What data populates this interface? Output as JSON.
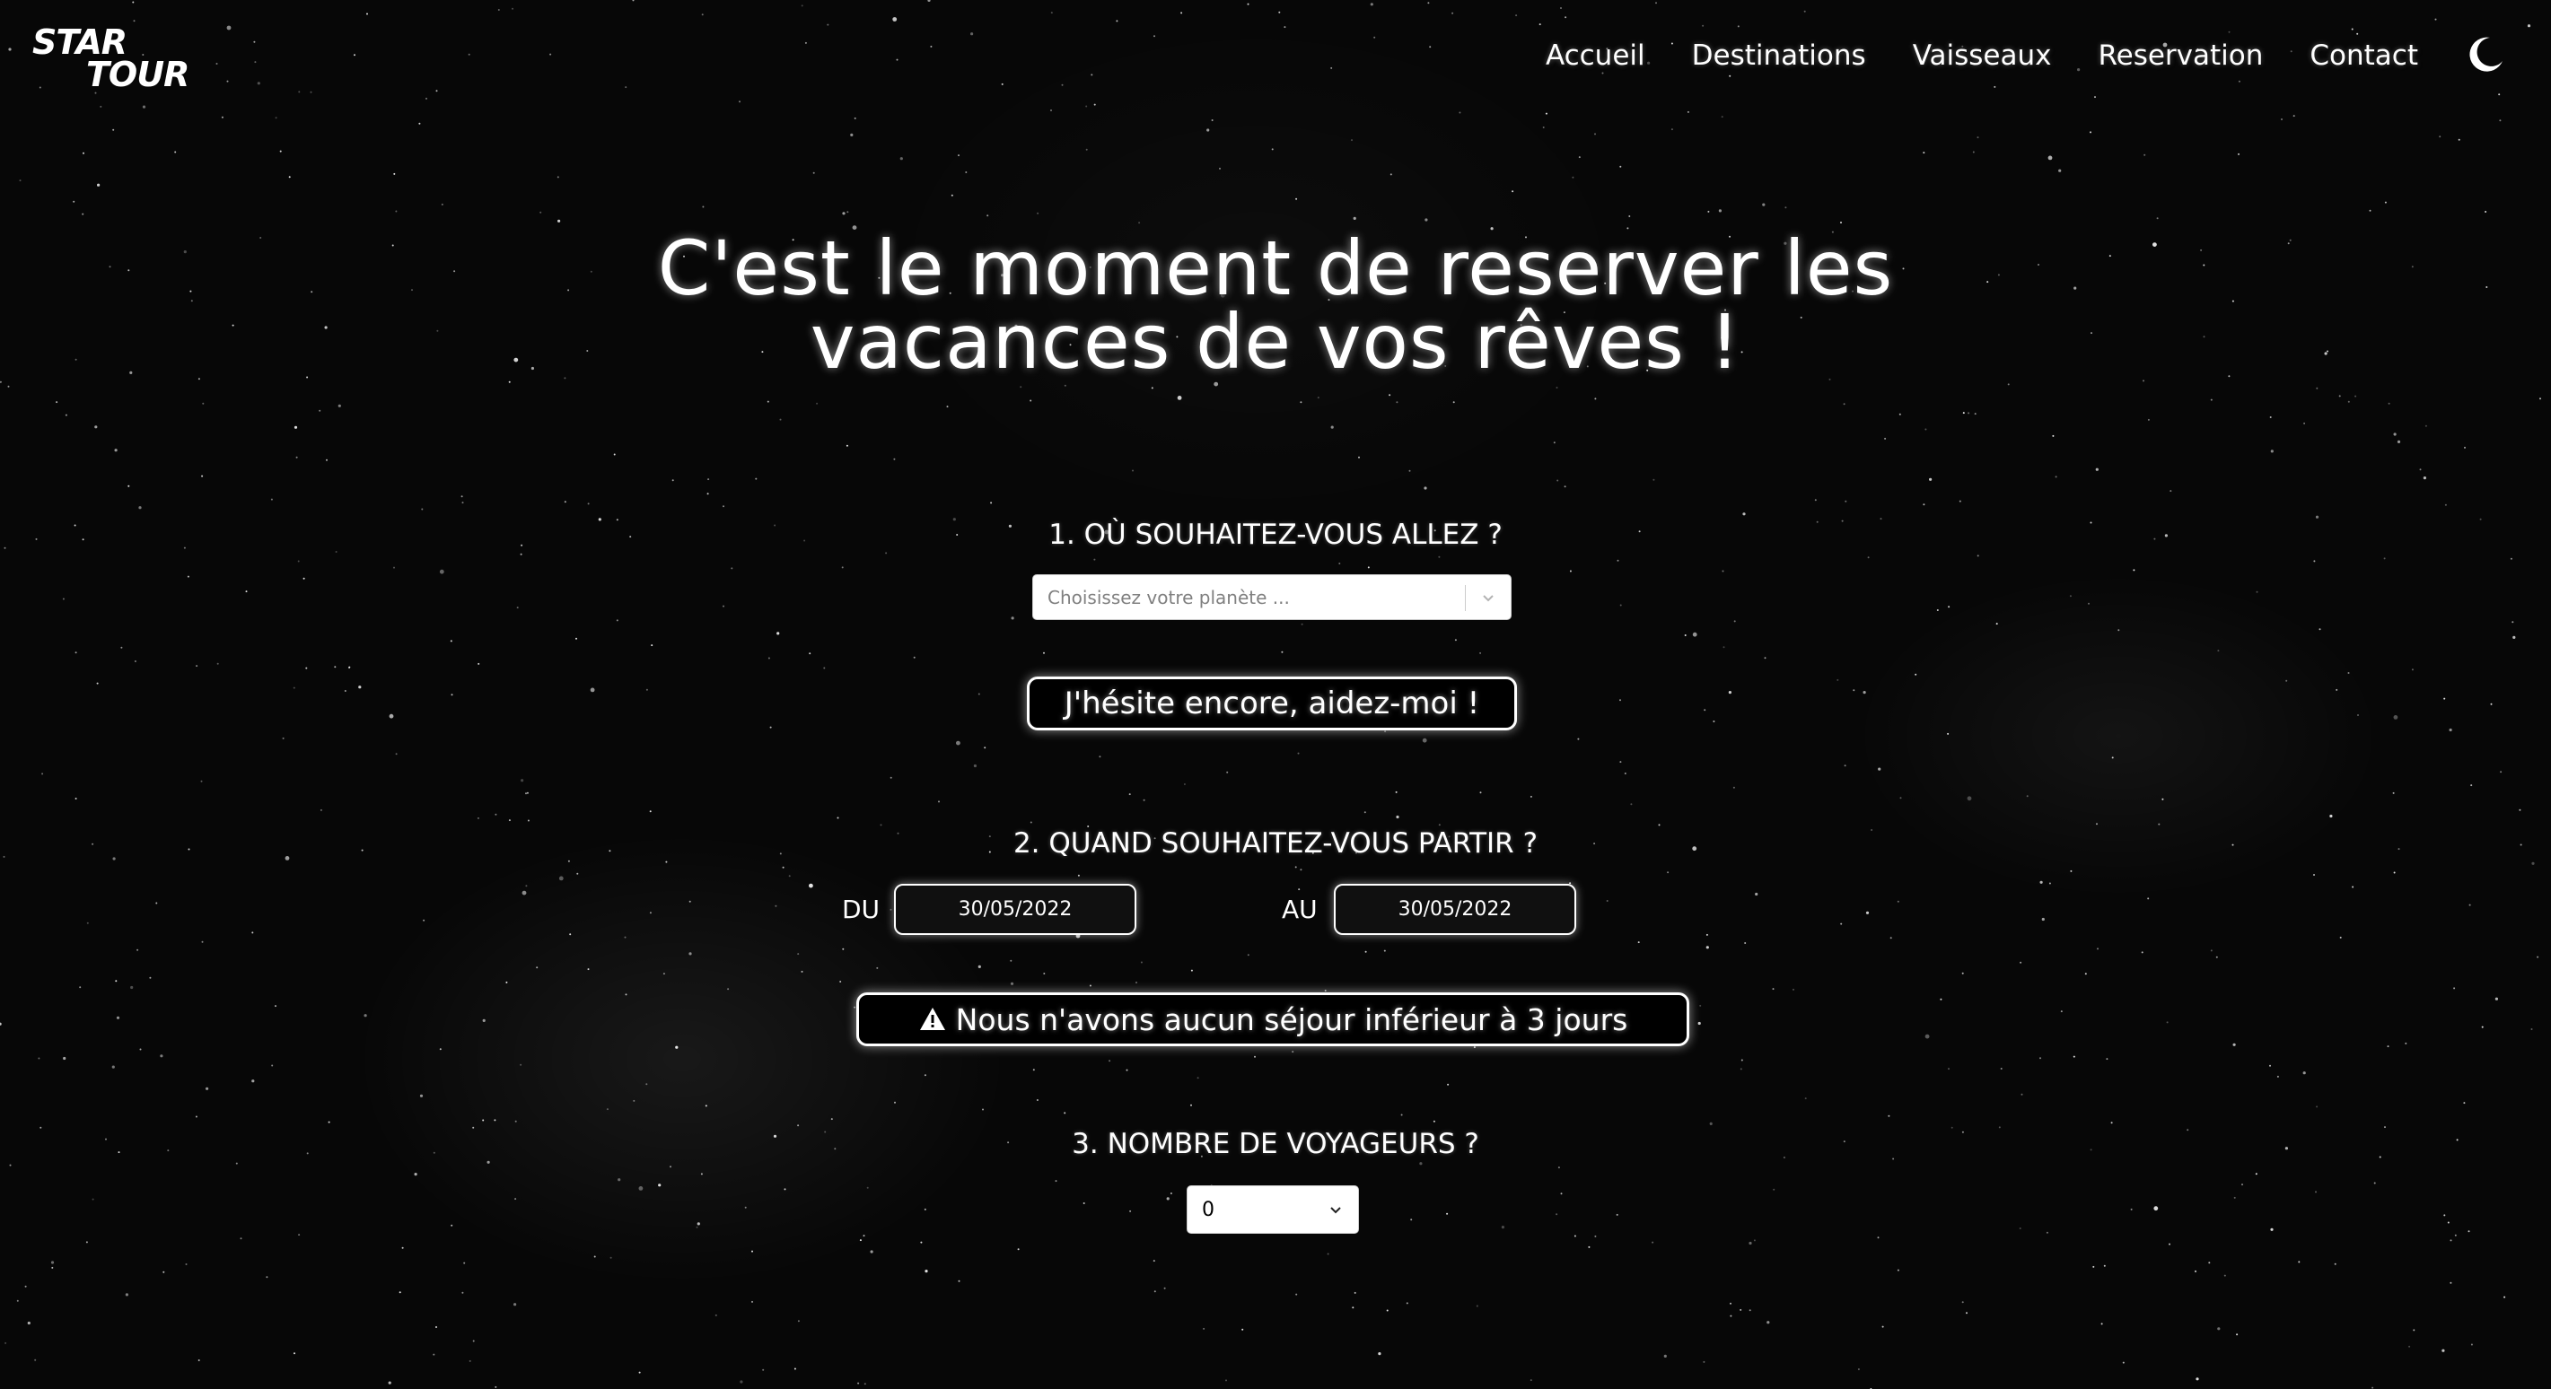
{
  "header": {
    "logo_line1": "STAR",
    "logo_line2": "TOUR",
    "nav": [
      "Accueil",
      "Destinations",
      "Vaisseaux",
      "Reservation",
      "Contact"
    ],
    "theme_toggle_icon": "moon-icon"
  },
  "hero": {
    "title_line1": "C'est le moment de reserver les",
    "title_line2": "vacances de vos rêves !"
  },
  "step1": {
    "label": "1. OÙ SOUHAITEZ-VOUS ALLEZ ?",
    "select_placeholder": "Choisissez votre planète ...",
    "help_button": "J'hésite encore, aidez-moi !"
  },
  "step2": {
    "label": "2. QUAND SOUHAITEZ-VOUS PARTIR ?",
    "from_label": "DU",
    "from_value": "30/05/2022",
    "to_label": "AU",
    "to_value": "30/05/2022",
    "warning_icon": "warning-icon",
    "warning_text": "Nous n'avons aucun séjour inférieur à 3 jours"
  },
  "step3": {
    "label": "3. NOMBRE DE VOYAGEURS ?",
    "selected_value": "0"
  },
  "colors": {
    "background": "#070707",
    "text": "#ffffff",
    "input_bg": "#ffffff"
  }
}
